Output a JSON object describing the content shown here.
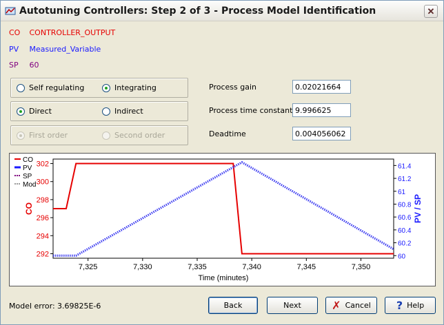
{
  "window": {
    "title": "Autotuning Controllers: Step 2 of 3 - Process Model Identification",
    "close_glyph": "✕"
  },
  "signals": [
    {
      "key": "CO",
      "name": "CONTROLLER_OUTPUT",
      "color": "#e60000"
    },
    {
      "key": "PV",
      "name": "Measured_Variable",
      "color": "#1a1aff"
    },
    {
      "key": "SP",
      "name": "60",
      "color": "#800080"
    }
  ],
  "options": {
    "row1": [
      {
        "label": "Self regulating",
        "selected": false,
        "enabled": true
      },
      {
        "label": "Integrating",
        "selected": true,
        "enabled": true
      }
    ],
    "row2": [
      {
        "label": "Direct",
        "selected": true,
        "enabled": true
      },
      {
        "label": "Indirect",
        "selected": false,
        "enabled": true
      }
    ],
    "row3": [
      {
        "label": "First order",
        "selected": true,
        "enabled": false
      },
      {
        "label": "Second order",
        "selected": false,
        "enabled": false
      }
    ]
  },
  "fields": [
    {
      "label": "Process gain",
      "value": "0.02021664"
    },
    {
      "label": "Process time constant",
      "value": "9.996625"
    },
    {
      "label": "Deadtime",
      "value": "0.004056062"
    }
  ],
  "chart_data": {
    "type": "line",
    "xlabel": "Time (minutes)",
    "ylabel_left": "CO",
    "ylabel_right": "PV / SP",
    "x_ticks": [
      7325,
      7330,
      7335,
      7340,
      7345,
      7350
    ],
    "x_tick_labels": [
      "7,325",
      "7,330",
      "7,335",
      "7,340",
      "7,345",
      "7,350"
    ],
    "xlim": [
      7321.8,
      7353.0
    ],
    "y_left_ticks": [
      292,
      294,
      296,
      298,
      300,
      302
    ],
    "ylim_left": [
      291.5,
      302.5
    ],
    "y_right_ticks": [
      60,
      60.2,
      60.4,
      60.6,
      60.8,
      61,
      61.2,
      61.4
    ],
    "y_right_tick_labels": [
      "60",
      "60.2",
      "60.4",
      "60.6",
      "60.8",
      "61",
      "61.2",
      "61.4"
    ],
    "ylim_right": [
      59.96,
      61.5
    ],
    "legend": [
      "CO",
      "PV",
      "SP",
      "Mod"
    ],
    "legend_position": "top-left",
    "series": [
      {
        "name": "CO",
        "axis": "left",
        "color": "#e60000",
        "x": [
          7321.8,
          7323.0,
          7323.9,
          7338.3,
          7339.1,
          7353.0
        ],
        "y": [
          297,
          297,
          302,
          302,
          292,
          292
        ]
      },
      {
        "name": "PV",
        "axis": "right",
        "color": "#1a1aff",
        "x": [
          7321.8,
          7323.9,
          7339.1,
          7353.0
        ],
        "y": [
          60.0,
          60.0,
          61.45,
          60.1
        ]
      },
      {
        "name": "Mod",
        "axis": "right",
        "color": "#9a9ac8",
        "x": [
          7321.8,
          7323.9,
          7339.1,
          7353.0
        ],
        "y": [
          60.0,
          60.0,
          61.45,
          60.1
        ]
      }
    ]
  },
  "footer": {
    "model_error_label": "Model error:",
    "model_error_value": "3.69825E-6",
    "back_label": "Back",
    "next_label": "Next",
    "cancel_label": "Cancel",
    "help_label": "Help"
  }
}
